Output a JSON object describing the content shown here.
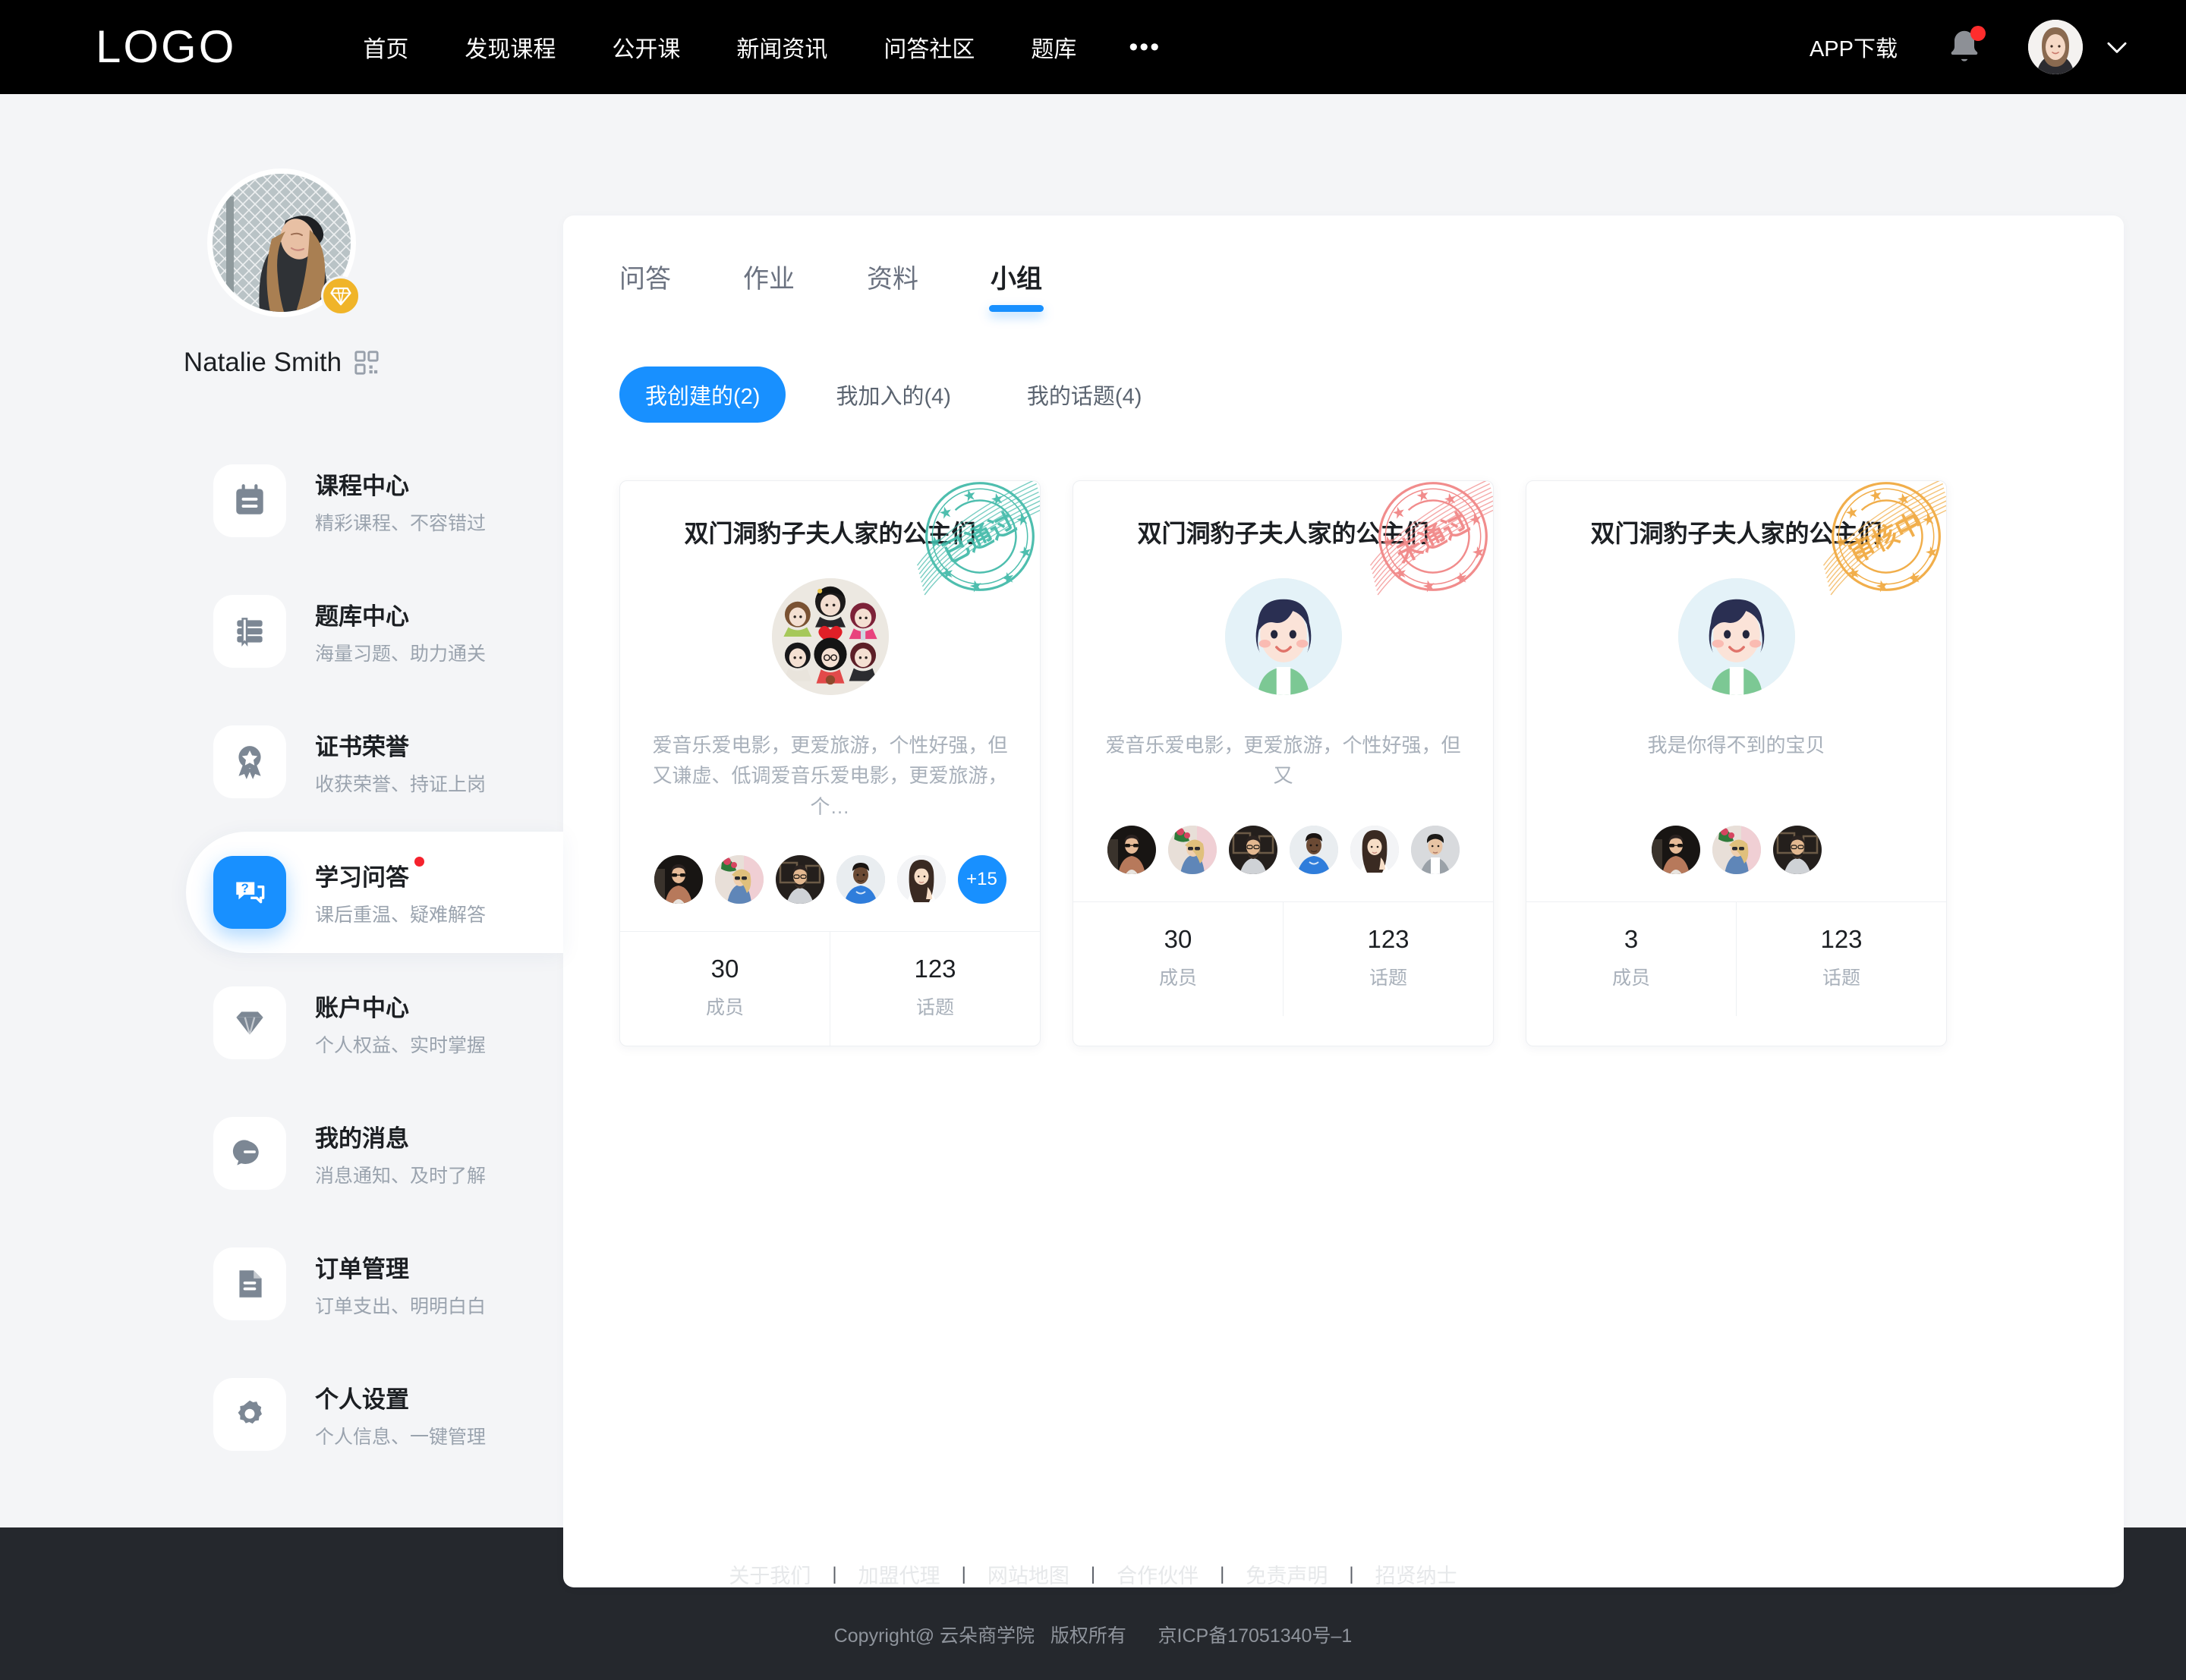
{
  "header": {
    "logo": "LOGO",
    "nav": [
      {
        "label": "首页"
      },
      {
        "label": "发现课程"
      },
      {
        "label": "公开课"
      },
      {
        "label": "新闻资讯"
      },
      {
        "label": "问答社区"
      },
      {
        "label": "题库"
      }
    ],
    "more": "•••",
    "app_download": "APP下载",
    "bell_icon": "bell-icon",
    "has_notification": true,
    "chevron": "chevron-down-icon"
  },
  "sidebar": {
    "profile": {
      "name": "Natalie Smith",
      "vip_icon": "diamond-icon",
      "qr_icon": "qr-code-icon"
    },
    "items": [
      {
        "title": "课程中心",
        "sub": "精彩课程、不容错过",
        "icon": "calendar-icon",
        "active": false,
        "dot": false
      },
      {
        "title": "题库中心",
        "sub": "海量习题、助力通关",
        "icon": "book-icon",
        "active": false,
        "dot": false
      },
      {
        "title": "证书荣誉",
        "sub": "收获荣誉、持证上岗",
        "icon": "medal-icon",
        "active": false,
        "dot": false
      },
      {
        "title": "学习问答",
        "sub": "课后重温、疑难解答",
        "icon": "qa-bubble-icon",
        "active": true,
        "dot": true
      },
      {
        "title": "账户中心",
        "sub": "个人权益、实时掌握",
        "icon": "diamond-icon",
        "active": false,
        "dot": false
      },
      {
        "title": "我的消息",
        "sub": "消息通知、及时了解",
        "icon": "chat-icon",
        "active": false,
        "dot": false
      },
      {
        "title": "订单管理",
        "sub": "订单支出、明明白白",
        "icon": "document-icon",
        "active": false,
        "dot": false
      },
      {
        "title": "个人设置",
        "sub": "个人信息、一键管理",
        "icon": "gear-icon",
        "active": false,
        "dot": false
      }
    ]
  },
  "main": {
    "tabs": [
      {
        "label": "问答",
        "active": false
      },
      {
        "label": "作业",
        "active": false
      },
      {
        "label": "资料",
        "active": false
      },
      {
        "label": "小组",
        "active": true
      }
    ],
    "subtabs": [
      {
        "label": "我创建的(2)",
        "active": true
      },
      {
        "label": "我加入的(4)",
        "active": false
      },
      {
        "label": "我的话题(4)",
        "active": false
      }
    ],
    "cards": [
      {
        "title": "双门洞豹子夫人家的公主们",
        "stamp_text": "已通过",
        "stamp_color": "#3fb9a8",
        "avatar_type": "group-collage",
        "desc": "爱音乐爱电影，更爱旅游，个性好强，但又谦虚、低调爱音乐爱电影，更爱旅游，个…",
        "member_count_visible": 5,
        "member_overflow": "+15",
        "stats": [
          {
            "num": "30",
            "label": "成员"
          },
          {
            "num": "123",
            "label": "话题"
          }
        ]
      },
      {
        "title": "双门洞豹子夫人家的公主们",
        "stamp_text": "未通过",
        "stamp_color": "#f08080",
        "avatar_type": "cartoon-boy",
        "desc": "爱音乐爱电影，更爱旅游，个性好强，但又",
        "member_count_visible": 6,
        "member_overflow": "",
        "stats": [
          {
            "num": "30",
            "label": "成员"
          },
          {
            "num": "123",
            "label": "话题"
          }
        ]
      },
      {
        "title": "双门洞豹子夫人家的公主们",
        "stamp_text": "审核中",
        "stamp_color": "#f0a83c",
        "avatar_type": "cartoon-boy",
        "desc": "我是你得不到的宝贝",
        "member_count_visible": 3,
        "member_overflow": "",
        "stats": [
          {
            "num": "3",
            "label": "成员"
          },
          {
            "num": "123",
            "label": "话题"
          }
        ]
      }
    ]
  },
  "footer": {
    "links": [
      "关于我们",
      "加盟代理",
      "网站地图",
      "合作伙伴",
      "免责声明",
      "招贤纳士"
    ],
    "separator": "|",
    "copyright": "Copyright@ 云朵商学院   版权所有      京ICP备17051340号–1"
  },
  "colors": {
    "accent": "#1890ff",
    "header_bg": "#000000",
    "page_bg": "#f4f5f7",
    "footer_bg": "#25282d",
    "vip_gold": "#f0b429",
    "badge_red": "#f5222d"
  }
}
